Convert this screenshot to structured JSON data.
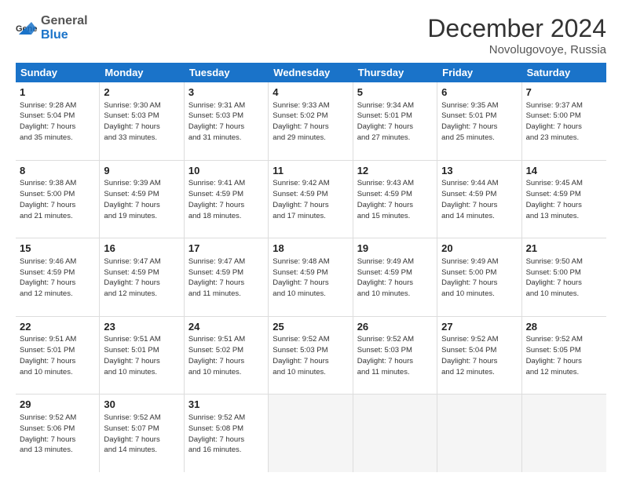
{
  "logo": {
    "text_general": "General",
    "text_blue": "Blue"
  },
  "header": {
    "month": "December 2024",
    "location": "Novolugovoye, Russia"
  },
  "days": [
    "Sunday",
    "Monday",
    "Tuesday",
    "Wednesday",
    "Thursday",
    "Friday",
    "Saturday"
  ],
  "weeks": [
    [
      {
        "day": "1",
        "rise": "9:28 AM",
        "set": "5:04 PM",
        "daylight": "7 hours and 35 minutes."
      },
      {
        "day": "2",
        "rise": "9:30 AM",
        "set": "5:03 PM",
        "daylight": "7 hours and 33 minutes."
      },
      {
        "day": "3",
        "rise": "9:31 AM",
        "set": "5:03 PM",
        "daylight": "7 hours and 31 minutes."
      },
      {
        "day": "4",
        "rise": "9:33 AM",
        "set": "5:02 PM",
        "daylight": "7 hours and 29 minutes."
      },
      {
        "day": "5",
        "rise": "9:34 AM",
        "set": "5:01 PM",
        "daylight": "7 hours and 27 minutes."
      },
      {
        "day": "6",
        "rise": "9:35 AM",
        "set": "5:01 PM",
        "daylight": "7 hours and 25 minutes."
      },
      {
        "day": "7",
        "rise": "9:37 AM",
        "set": "5:00 PM",
        "daylight": "7 hours and 23 minutes."
      }
    ],
    [
      {
        "day": "8",
        "rise": "9:38 AM",
        "set": "5:00 PM",
        "daylight": "7 hours and 21 minutes."
      },
      {
        "day": "9",
        "rise": "9:39 AM",
        "set": "4:59 PM",
        "daylight": "7 hours and 19 minutes."
      },
      {
        "day": "10",
        "rise": "9:41 AM",
        "set": "4:59 PM",
        "daylight": "7 hours and 18 minutes."
      },
      {
        "day": "11",
        "rise": "9:42 AM",
        "set": "4:59 PM",
        "daylight": "7 hours and 17 minutes."
      },
      {
        "day": "12",
        "rise": "9:43 AM",
        "set": "4:59 PM",
        "daylight": "7 hours and 15 minutes."
      },
      {
        "day": "13",
        "rise": "9:44 AM",
        "set": "4:59 PM",
        "daylight": "7 hours and 14 minutes."
      },
      {
        "day": "14",
        "rise": "9:45 AM",
        "set": "4:59 PM",
        "daylight": "7 hours and 13 minutes."
      }
    ],
    [
      {
        "day": "15",
        "rise": "9:46 AM",
        "set": "4:59 PM",
        "daylight": "7 hours and 12 minutes."
      },
      {
        "day": "16",
        "rise": "9:47 AM",
        "set": "4:59 PM",
        "daylight": "7 hours and 12 minutes."
      },
      {
        "day": "17",
        "rise": "9:47 AM",
        "set": "4:59 PM",
        "daylight": "7 hours and 11 minutes."
      },
      {
        "day": "18",
        "rise": "9:48 AM",
        "set": "4:59 PM",
        "daylight": "7 hours and 10 minutes."
      },
      {
        "day": "19",
        "rise": "9:49 AM",
        "set": "4:59 PM",
        "daylight": "7 hours and 10 minutes."
      },
      {
        "day": "20",
        "rise": "9:49 AM",
        "set": "5:00 PM",
        "daylight": "7 hours and 10 minutes."
      },
      {
        "day": "21",
        "rise": "9:50 AM",
        "set": "5:00 PM",
        "daylight": "7 hours and 10 minutes."
      }
    ],
    [
      {
        "day": "22",
        "rise": "9:51 AM",
        "set": "5:01 PM",
        "daylight": "7 hours and 10 minutes."
      },
      {
        "day": "23",
        "rise": "9:51 AM",
        "set": "5:01 PM",
        "daylight": "7 hours and 10 minutes."
      },
      {
        "day": "24",
        "rise": "9:51 AM",
        "set": "5:02 PM",
        "daylight": "7 hours and 10 minutes."
      },
      {
        "day": "25",
        "rise": "9:52 AM",
        "set": "5:03 PM",
        "daylight": "7 hours and 10 minutes."
      },
      {
        "day": "26",
        "rise": "9:52 AM",
        "set": "5:03 PM",
        "daylight": "7 hours and 11 minutes."
      },
      {
        "day": "27",
        "rise": "9:52 AM",
        "set": "5:04 PM",
        "daylight": "7 hours and 12 minutes."
      },
      {
        "day": "28",
        "rise": "9:52 AM",
        "set": "5:05 PM",
        "daylight": "7 hours and 12 minutes."
      }
    ],
    [
      {
        "day": "29",
        "rise": "9:52 AM",
        "set": "5:06 PM",
        "daylight": "7 hours and 13 minutes."
      },
      {
        "day": "30",
        "rise": "9:52 AM",
        "set": "5:07 PM",
        "daylight": "7 hours and 14 minutes."
      },
      {
        "day": "31",
        "rise": "9:52 AM",
        "set": "5:08 PM",
        "daylight": "7 hours and 16 minutes."
      },
      null,
      null,
      null,
      null
    ]
  ]
}
